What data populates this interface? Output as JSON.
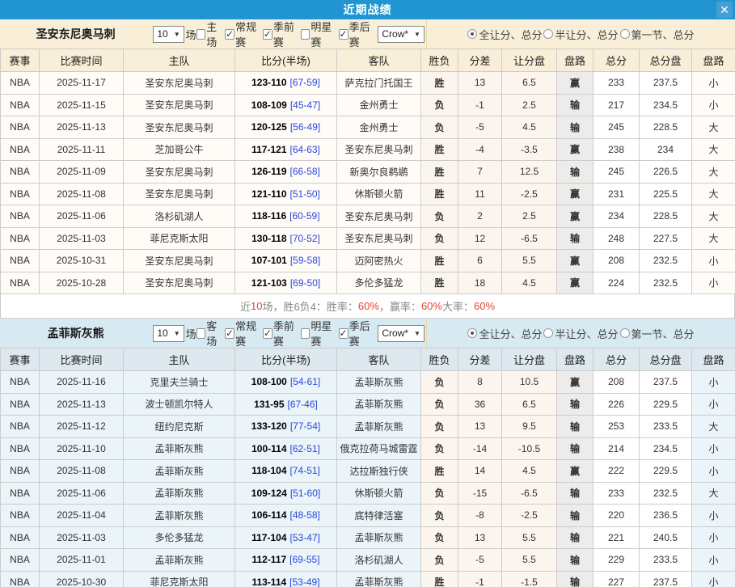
{
  "titlebar": {
    "title": "近期战绩",
    "close_icon": "✕"
  },
  "colors": {
    "titlebar_blue": "#2095d2",
    "cream_panel": "#f9efd8",
    "blue_panel": "#d7eaf2",
    "win_red": "#e60000",
    "loss_green": "#008b2e",
    "total_blue": "#2b2bdd",
    "highlight_team_green": "#089408"
  },
  "table_headers": [
    "赛事",
    "比赛时间",
    "主队",
    "比分(半场)",
    "客队",
    "胜负",
    "分差",
    "让分盘",
    "盘路",
    "总分",
    "总分盘",
    "盘路"
  ],
  "sections": [
    {
      "id": "san-antonio-spurs",
      "team": "圣安东尼奥马刺",
      "games_select": "10",
      "games_unit": "场",
      "checkboxes": [
        {
          "key": "home-venue",
          "label": "主场",
          "checked": false
        },
        {
          "key": "regular-season",
          "label": "常规赛",
          "checked": true
        },
        {
          "key": "preseason",
          "label": "季前赛",
          "checked": true
        },
        {
          "key": "all-star",
          "label": "明星赛",
          "checked": false
        },
        {
          "key": "playoffs",
          "label": "季后赛",
          "checked": true
        }
      ],
      "bookmaker_select": "Crow*",
      "radios": [
        {
          "key": "full-game-handicap-total",
          "label": "全让分、总分",
          "selected": true
        },
        {
          "key": "half-game-handicap-total",
          "label": "半让分、总分",
          "selected": false
        },
        {
          "key": "first-quarter-handicap-total",
          "label": "第一节、总分",
          "selected": false
        }
      ],
      "rows": [
        {
          "league": "NBA",
          "date": "2025-11-17",
          "home": "圣安东尼奥马刺",
          "home_hl": true,
          "score": "123-110",
          "half": "[67-59]",
          "away": "萨克拉门托国王",
          "away_hl": false,
          "result": "胜",
          "diff": "13",
          "line": "6.5",
          "cover": "赢",
          "total": "233",
          "total_line": "237.5",
          "ou": "小"
        },
        {
          "league": "NBA",
          "date": "2025-11-15",
          "home": "圣安东尼奥马刺",
          "home_hl": true,
          "score": "108-109",
          "half": "[45-47]",
          "away": "金州勇士",
          "away_hl": false,
          "result": "负",
          "diff": "-1",
          "line": "2.5",
          "cover": "输",
          "total": "217",
          "total_line": "234.5",
          "ou": "小"
        },
        {
          "league": "NBA",
          "date": "2025-11-13",
          "home": "圣安东尼奥马刺",
          "home_hl": true,
          "score": "120-125",
          "half": "[56-49]",
          "away": "金州勇士",
          "away_hl": false,
          "result": "负",
          "diff": "-5",
          "line": "4.5",
          "cover": "输",
          "total": "245",
          "total_line": "228.5",
          "ou": "大"
        },
        {
          "league": "NBA",
          "date": "2025-11-11",
          "home": "芝加哥公牛",
          "home_hl": false,
          "score": "117-121",
          "half": "[64-63]",
          "away": "圣安东尼奥马刺",
          "away_hl": true,
          "result": "胜",
          "diff": "-4",
          "line": "-3.5",
          "cover": "赢",
          "total": "238",
          "total_line": "234",
          "ou": "大"
        },
        {
          "league": "NBA",
          "date": "2025-11-09",
          "home": "圣安东尼奥马刺",
          "home_hl": true,
          "score": "126-119",
          "half": "[66-58]",
          "away": "新奥尔良鹈鹕",
          "away_hl": false,
          "result": "胜",
          "diff": "7",
          "line": "12.5",
          "cover": "输",
          "total": "245",
          "total_line": "226.5",
          "ou": "大"
        },
        {
          "league": "NBA",
          "date": "2025-11-08",
          "home": "圣安东尼奥马刺",
          "home_hl": true,
          "score": "121-110",
          "half": "[51-50]",
          "away": "休斯顿火箭",
          "away_hl": false,
          "result": "胜",
          "diff": "11",
          "line": "-2.5",
          "cover": "赢",
          "total": "231",
          "total_line": "225.5",
          "ou": "大"
        },
        {
          "league": "NBA",
          "date": "2025-11-06",
          "home": "洛杉矶湖人",
          "home_hl": false,
          "score": "118-116",
          "half": "[60-59]",
          "away": "圣安东尼奥马刺",
          "away_hl": true,
          "result": "负",
          "diff": "2",
          "line": "2.5",
          "cover": "赢",
          "total": "234",
          "total_line": "228.5",
          "ou": "大"
        },
        {
          "league": "NBA",
          "date": "2025-11-03",
          "home": "菲尼克斯太阳",
          "home_hl": false,
          "score": "130-118",
          "half": "[70-52]",
          "away": "圣安东尼奥马刺",
          "away_hl": true,
          "result": "负",
          "diff": "12",
          "line": "-6.5",
          "cover": "输",
          "total": "248",
          "total_line": "227.5",
          "ou": "大"
        },
        {
          "league": "NBA",
          "date": "2025-10-31",
          "home": "圣安东尼奥马刺",
          "home_hl": true,
          "score": "107-101",
          "half": "[59-58]",
          "away": "迈阿密热火",
          "away_hl": false,
          "result": "胜",
          "diff": "6",
          "line": "5.5",
          "cover": "赢",
          "total": "208",
          "total_line": "232.5",
          "ou": "小"
        },
        {
          "league": "NBA",
          "date": "2025-10-28",
          "home": "圣安东尼奥马刺",
          "home_hl": true,
          "score": "121-103",
          "half": "[69-50]",
          "away": "多伦多猛龙",
          "away_hl": false,
          "result": "胜",
          "diff": "18",
          "line": "4.5",
          "cover": "赢",
          "total": "224",
          "total_line": "232.5",
          "ou": "小"
        }
      ],
      "summary": [
        {
          "text": "近 ",
          "red": false
        },
        {
          "text": "10",
          "red": true
        },
        {
          "text": " 场，胜6负4：胜率：",
          "red": false
        },
        {
          "text": "60%",
          "red": true
        },
        {
          "text": "，赢率：",
          "red": false
        },
        {
          "text": "60%",
          "red": true
        },
        {
          "text": " 大率：",
          "red": false
        },
        {
          "text": "60%",
          "red": true
        }
      ]
    },
    {
      "id": "memphis-grizzlies",
      "team": "孟菲斯灰熊",
      "games_select": "10",
      "games_unit": "场",
      "checkboxes": [
        {
          "key": "away-venue",
          "label": "客场",
          "checked": false
        },
        {
          "key": "regular-season",
          "label": "常规赛",
          "checked": true
        },
        {
          "key": "preseason",
          "label": "季前赛",
          "checked": true
        },
        {
          "key": "all-star",
          "label": "明星赛",
          "checked": false
        },
        {
          "key": "playoffs",
          "label": "季后赛",
          "checked": true
        }
      ],
      "bookmaker_select": "Crow*",
      "radios": [
        {
          "key": "full-game-handicap-total",
          "label": "全让分、总分",
          "selected": true
        },
        {
          "key": "half-game-handicap-total",
          "label": "半让分、总分",
          "selected": false
        },
        {
          "key": "first-quarter-handicap-total",
          "label": "第一节、总分",
          "selected": false
        }
      ],
      "rows": [
        {
          "league": "NBA",
          "date": "2025-11-16",
          "home": "克里夫兰骑士",
          "home_hl": false,
          "score": "108-100",
          "half": "[54-61]",
          "away": "孟菲斯灰熊",
          "away_hl": true,
          "result": "负",
          "diff": "8",
          "line": "10.5",
          "cover": "赢",
          "total": "208",
          "total_line": "237.5",
          "ou": "小"
        },
        {
          "league": "NBA",
          "date": "2025-11-13",
          "home": "波士顿凯尔特人",
          "home_hl": false,
          "score": "131-95",
          "half": "[67-46]",
          "away": "孟菲斯灰熊",
          "away_hl": true,
          "result": "负",
          "diff": "36",
          "line": "6.5",
          "cover": "输",
          "total": "226",
          "total_line": "229.5",
          "ou": "小"
        },
        {
          "league": "NBA",
          "date": "2025-11-12",
          "home": "纽约尼克斯",
          "home_hl": false,
          "score": "133-120",
          "half": "[77-54]",
          "away": "孟菲斯灰熊",
          "away_hl": true,
          "result": "负",
          "diff": "13",
          "line": "9.5",
          "cover": "输",
          "total": "253",
          "total_line": "233.5",
          "ou": "大"
        },
        {
          "league": "NBA",
          "date": "2025-11-10",
          "home": "孟菲斯灰熊",
          "home_hl": true,
          "score": "100-114",
          "half": "[62-51]",
          "away": "俄克拉荷马城雷霆",
          "away_hl": false,
          "result": "负",
          "diff": "-14",
          "line": "-10.5",
          "cover": "输",
          "total": "214",
          "total_line": "234.5",
          "ou": "小"
        },
        {
          "league": "NBA",
          "date": "2025-11-08",
          "home": "孟菲斯灰熊",
          "home_hl": true,
          "score": "118-104",
          "half": "[74-51]",
          "away": "达拉斯独行侠",
          "away_hl": false,
          "result": "胜",
          "diff": "14",
          "line": "4.5",
          "cover": "赢",
          "total": "222",
          "total_line": "229.5",
          "ou": "小"
        },
        {
          "league": "NBA",
          "date": "2025-11-06",
          "home": "孟菲斯灰熊",
          "home_hl": true,
          "score": "109-124",
          "half": "[51-60]",
          "away": "休斯顿火箭",
          "away_hl": false,
          "result": "负",
          "diff": "-15",
          "line": "-6.5",
          "cover": "输",
          "total": "233",
          "total_line": "232.5",
          "ou": "大"
        },
        {
          "league": "NBA",
          "date": "2025-11-04",
          "home": "孟菲斯灰熊",
          "home_hl": true,
          "score": "106-114",
          "half": "[48-58]",
          "away": "底特律活塞",
          "away_hl": false,
          "result": "负",
          "diff": "-8",
          "line": "-2.5",
          "cover": "输",
          "total": "220",
          "total_line": "236.5",
          "ou": "小"
        },
        {
          "league": "NBA",
          "date": "2025-11-03",
          "home": "多伦多猛龙",
          "home_hl": false,
          "score": "117-104",
          "half": "[53-47]",
          "away": "孟菲斯灰熊",
          "away_hl": true,
          "result": "负",
          "diff": "13",
          "line": "5.5",
          "cover": "输",
          "total": "221",
          "total_line": "240.5",
          "ou": "小"
        },
        {
          "league": "NBA",
          "date": "2025-11-01",
          "home": "孟菲斯灰熊",
          "home_hl": true,
          "score": "112-117",
          "half": "[69-55]",
          "away": "洛杉矶湖人",
          "away_hl": false,
          "result": "负",
          "diff": "-5",
          "line": "5.5",
          "cover": "输",
          "total": "229",
          "total_line": "233.5",
          "ou": "小"
        },
        {
          "league": "NBA",
          "date": "2025-10-30",
          "home": "菲尼克斯太阳",
          "home_hl": false,
          "score": "113-114",
          "half": "[53-49]",
          "away": "孟菲斯灰熊",
          "away_hl": true,
          "result": "胜",
          "diff": "-1",
          "line": "-1.5",
          "cover": "输",
          "total": "227",
          "total_line": "237.5",
          "ou": "小"
        }
      ],
      "summary": null
    }
  ]
}
